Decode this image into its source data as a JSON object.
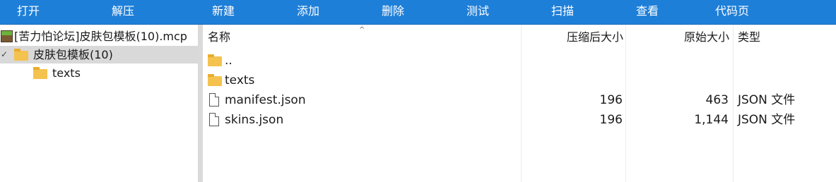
{
  "toolbar": {
    "open": "打开",
    "extract": "解压",
    "new": "新建",
    "add": "添加",
    "delete": "删除",
    "test": "测试",
    "scan": "扫描",
    "view": "查看",
    "codepage": "代码页"
  },
  "tree": {
    "archive_name": "[苦力怕论坛]皮肤包模板(10).mcp",
    "expand_glyph": "✓",
    "folder_root": "皮肤包模板(10)",
    "folder_child": "texts"
  },
  "list": {
    "headers": {
      "name": "名称",
      "packed_size": "压缩后大小",
      "original_size": "原始大小",
      "type": "类型"
    },
    "sort_indicator": "^",
    "rows": [
      {
        "name": "..",
        "packed": "",
        "original": "",
        "type": ""
      },
      {
        "name": "texts",
        "packed": "",
        "original": "",
        "type": ""
      },
      {
        "name": "manifest.json",
        "packed": "196",
        "original": "463",
        "type": "JSON 文件"
      },
      {
        "name": "skins.json",
        "packed": "196",
        "original": "1,144",
        "type": "JSON 文件"
      }
    ]
  },
  "colors": {
    "toolbar_bg": "#1e7fd8",
    "selection_bg": "#d9d9d9",
    "folder": "#f4c24e"
  }
}
